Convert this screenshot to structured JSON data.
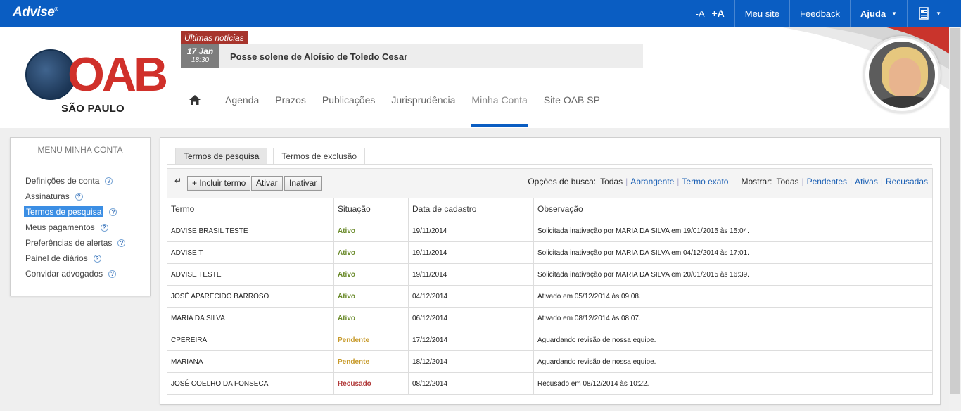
{
  "topbar": {
    "brand": "Advise",
    "font_decrease": "-A",
    "font_increase": "+A",
    "meu_site": "Meu site",
    "feedback": "Feedback",
    "ajuda": "Ajuda",
    "account_icon": "contact-card-icon"
  },
  "logo": {
    "name": "OAB",
    "subtitle": "SÃO PAULO"
  },
  "news": {
    "label": "Últimas notícias",
    "date": "17 Jan",
    "time": "18:30",
    "title": "Posse solene de Aloísio de Toledo Cesar"
  },
  "nav": {
    "items": [
      "Agenda",
      "Prazos",
      "Publicações",
      "Jurisprudência",
      "Minha Conta",
      "Site OAB SP"
    ],
    "active": "Minha Conta"
  },
  "sidebar": {
    "title": "MENU MINHA CONTA",
    "items": [
      {
        "label": "Definições de conta"
      },
      {
        "label": "Assinaturas"
      },
      {
        "label": "Termos de pesquisa"
      },
      {
        "label": "Meus pagamentos"
      },
      {
        "label": "Preferências de alertas"
      },
      {
        "label": "Painel de diários"
      },
      {
        "label": "Convidar advogados"
      }
    ],
    "help": "?"
  },
  "tabs": [
    "Termos de pesquisa",
    "Termos de exclusão"
  ],
  "toolbar": {
    "include": "+ Incluir termo",
    "activate": "Ativar",
    "deactivate": "Inativar",
    "search_options_label": "Opções de busca:",
    "search_options": [
      "Todas",
      "Abrangente",
      "Termo exato"
    ],
    "show_label": "Mostrar:",
    "show_options": [
      "Todas",
      "Pendentes",
      "Ativas",
      "Recusadas"
    ]
  },
  "table": {
    "headers": [
      "Termo",
      "Situação",
      "Data de cadastro",
      "Observação"
    ],
    "rows": [
      [
        "ADVISE BRASIL TESTE",
        "Ativo",
        "19/11/2014",
        "Solicitada inativação por MARIA DA SILVA em 19/01/2015 às 15:04."
      ],
      [
        "ADVISE T",
        "Ativo",
        "19/11/2014",
        "Solicitada inativação por MARIA DA SILVA em 04/12/2014 às 17:01."
      ],
      [
        "ADVISE TESTE",
        "Ativo",
        "19/11/2014",
        "Solicitada inativação por MARIA DA SILVA em 20/01/2015 às 16:39."
      ],
      [
        "JOSÉ APARECIDO BARROSO",
        "Ativo",
        "04/12/2014",
        "Ativado em 05/12/2014 às 09:08."
      ],
      [
        "MARIA DA SILVA",
        "Ativo",
        "06/12/2014",
        "Ativado em 08/12/2014 às 08:07."
      ],
      [
        "CPEREIRA",
        "Pendente",
        "17/12/2014",
        "Aguardando revisão de nossa equipe."
      ],
      [
        "MARIANA",
        "Pendente",
        "18/12/2014",
        "Aguardando revisão de nossa equipe."
      ],
      [
        "JOSÉ COELHO DA FONSECA",
        "Recusado",
        "08/12/2014",
        "Recusado em 08/12/2014 às 10:22."
      ]
    ]
  },
  "colors": {
    "topbar": "#0a5dc2",
    "accent_red": "#d0302a",
    "active_menu": "#3b8ee4",
    "ativo": "#6a8a2a",
    "pendente": "#c79a2a",
    "recusado": "#b13a3a"
  }
}
